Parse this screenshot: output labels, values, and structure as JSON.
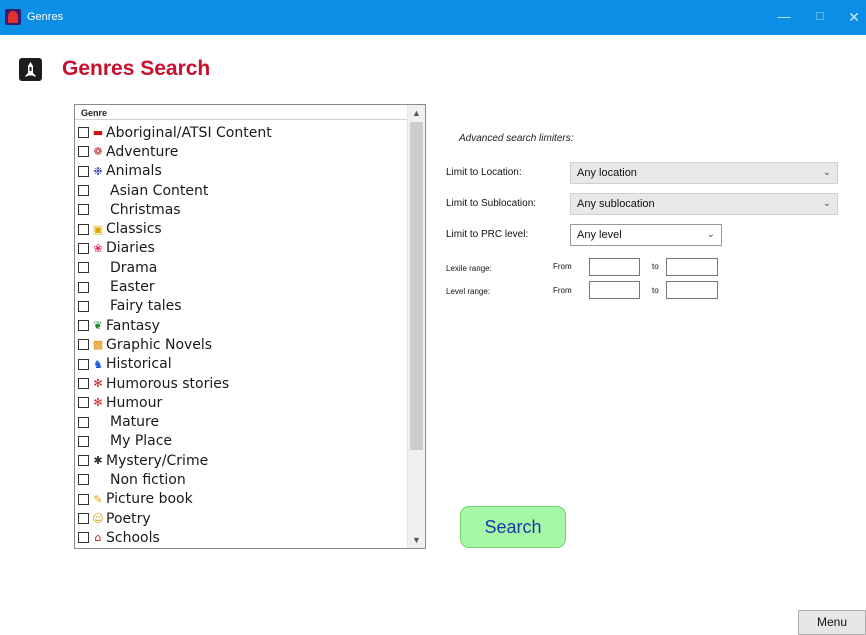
{
  "window": {
    "title": "Genres"
  },
  "header": {
    "title": "Genres Search"
  },
  "genre_list": {
    "column_header": "Genre",
    "items": [
      {
        "label": "Aboriginal/ATSI Content",
        "icon": "flag-icon"
      },
      {
        "label": "Adventure",
        "icon": "compass-icon"
      },
      {
        "label": "Animals",
        "icon": "paw-icon"
      },
      {
        "label": "Asian Content",
        "icon": ""
      },
      {
        "label": "Christmas",
        "icon": ""
      },
      {
        "label": "Classics",
        "icon": "book-icon"
      },
      {
        "label": "Diaries",
        "icon": "flower-icon"
      },
      {
        "label": "Drama",
        "icon": ""
      },
      {
        "label": "Easter",
        "icon": ""
      },
      {
        "label": "Fairy tales",
        "icon": ""
      },
      {
        "label": "Fantasy",
        "icon": "dragon-icon"
      },
      {
        "label": "Graphic Novels",
        "icon": "comic-icon"
      },
      {
        "label": "Historical",
        "icon": "knight-icon"
      },
      {
        "label": "Humorous stories",
        "icon": "jester-icon"
      },
      {
        "label": "Humour",
        "icon": "jester-icon"
      },
      {
        "label": "Mature",
        "icon": ""
      },
      {
        "label": "My Place",
        "icon": ""
      },
      {
        "label": "Mystery/Crime",
        "icon": "spider-icon"
      },
      {
        "label": "Non fiction",
        "icon": ""
      },
      {
        "label": "Picture book",
        "icon": "pencil-icon"
      },
      {
        "label": "Poetry",
        "icon": "quill-icon"
      },
      {
        "label": "Schools",
        "icon": "school-icon"
      }
    ]
  },
  "limiters": {
    "title": "Advanced search limiters:",
    "location_label": "Limit to Location:",
    "location_value": "Any location",
    "sublocation_label": "Limit to Sublocation:",
    "sublocation_value": "Any sublocation",
    "prc_label": "Limit to PRC level:",
    "prc_value": "Any level",
    "lexile_label": "Lexile range:",
    "level_label": "Level range:",
    "from_label": "From",
    "to_label": "to"
  },
  "buttons": {
    "search": "Search",
    "menu": "Menu"
  },
  "colors": {
    "titlebar": "#0a8ee6",
    "page_title": "#c8102e",
    "search_bg": "#a6f7a6",
    "search_text": "#1a3aa8"
  }
}
